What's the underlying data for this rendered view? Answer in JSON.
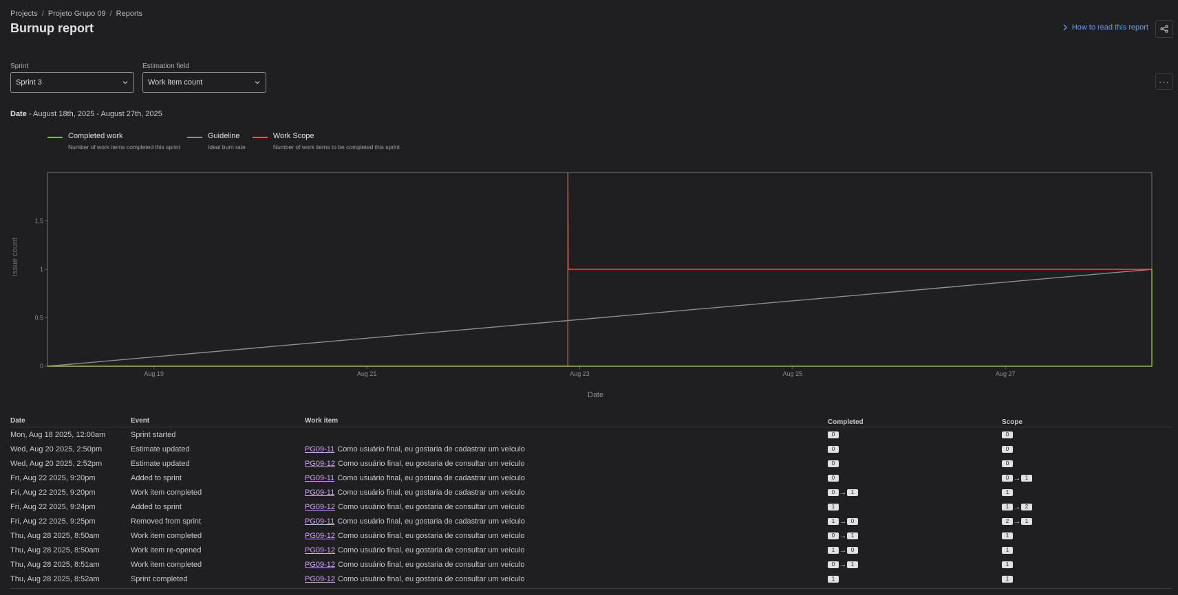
{
  "breadcrumb": {
    "projects": "Projects",
    "project": "Projeto Grupo 09",
    "reports": "Reports",
    "sep": "/"
  },
  "title": "Burnup report",
  "header": {
    "howto_label": "How to read this report"
  },
  "filters": {
    "sprint_label": "Sprint",
    "sprint_value": "Sprint 3",
    "estimation_label": "Estimation field",
    "estimation_value": "Work item count"
  },
  "date_range": {
    "label": "Date",
    "value": "- August 18th, 2025 - August 27th, 2025"
  },
  "legend": [
    {
      "name": "Completed work",
      "desc": "Number of work items completed this sprint",
      "color": "#82b536"
    },
    {
      "name": "Guideline",
      "desc": "Ideal burn rate",
      "color": "#8c8f93"
    },
    {
      "name": "Work Scope",
      "desc": "Number of work items to be completed this sprint",
      "color": "#e5534b"
    }
  ],
  "chart_data": {
    "type": "line",
    "xlabel": "Date",
    "ylabel": "Issue count",
    "x_ticks": [
      "Aug 19",
      "Aug 21",
      "Aug 23",
      "Aug 25",
      "Aug 27"
    ],
    "y_ticks": [
      "0",
      "0.5",
      "1",
      "1.5"
    ],
    "ylim": [
      0,
      2
    ],
    "xlim": [
      "2025-08-18",
      "2025-08-28 09:00"
    ],
    "grid": false,
    "legend_position": "top-left",
    "series": [
      {
        "name": "Completed work",
        "color": "#82b536",
        "points": [
          [
            "2025-08-18",
            0
          ],
          [
            "2025-08-28 09:00",
            0
          ],
          [
            "2025-08-28 09:00",
            1
          ]
        ]
      },
      {
        "name": "Guideline",
        "color": "#8c8f93",
        "points": [
          [
            "2025-08-18",
            0
          ],
          [
            "2025-08-28 09:00",
            1
          ]
        ]
      },
      {
        "name": "Work Scope",
        "color": "#e5534b",
        "points": [
          [
            "2025-08-18",
            0
          ],
          [
            "2025-08-22 21:20",
            0
          ],
          [
            "2025-08-22 21:20",
            2
          ],
          [
            "2025-08-22 21:25",
            1
          ],
          [
            "2025-08-28 09:00",
            1
          ]
        ]
      }
    ]
  },
  "table": {
    "headers": {
      "date": "Date",
      "event": "Event",
      "item": "Work item",
      "completed": "Completed",
      "scope": "Scope"
    },
    "rows": [
      {
        "date": "Mon, Aug 18 2025, 12:00am",
        "event": "Sprint started",
        "key": "",
        "summary": "",
        "completed": [
          "0"
        ],
        "scope": [
          "0"
        ]
      },
      {
        "date": "Wed, Aug 20 2025, 2:50pm",
        "event": "Estimate updated",
        "key": "PG09-11",
        "summary": "Como usuário final, eu gostaria de cadastrar um veículo",
        "completed": [
          "0"
        ],
        "scope": [
          "0"
        ]
      },
      {
        "date": "Wed, Aug 20 2025, 2:52pm",
        "event": "Estimate updated",
        "key": "PG09-12",
        "summary": "Como usuário final, eu gostaria de consultar um veículo",
        "completed": [
          "0"
        ],
        "scope": [
          "0"
        ]
      },
      {
        "date": "Fri, Aug 22 2025, 9:20pm",
        "event": "Added to sprint",
        "key": "PG09-11",
        "summary": "Como usuário final, eu gostaria de cadastrar um veículo",
        "completed": [
          "0"
        ],
        "scope": [
          "0",
          "1"
        ]
      },
      {
        "date": "Fri, Aug 22 2025, 9:20pm",
        "event": "Work item completed",
        "key": "PG09-11",
        "summary": "Como usuário final, eu gostaria de cadastrar um veículo",
        "completed": [
          "0",
          "1"
        ],
        "scope": [
          "1"
        ]
      },
      {
        "date": "Fri, Aug 22 2025, 9:24pm",
        "event": "Added to sprint",
        "key": "PG09-12",
        "summary": "Como usuário final, eu gostaria de consultar um veículo",
        "completed": [
          "1"
        ],
        "scope": [
          "1",
          "2"
        ]
      },
      {
        "date": "Fri, Aug 22 2025, 9:25pm",
        "event": "Removed from sprint",
        "key": "PG09-11",
        "summary": "Como usuário final, eu gostaria de cadastrar um veículo",
        "completed": [
          "1",
          "0"
        ],
        "scope": [
          "2",
          "1"
        ]
      },
      {
        "date": "Thu, Aug 28 2025, 8:50am",
        "event": "Work item completed",
        "key": "PG09-12",
        "summary": "Como usuário final, eu gostaria de consultar um veículo",
        "completed": [
          "0",
          "1"
        ],
        "scope": [
          "1"
        ]
      },
      {
        "date": "Thu, Aug 28 2025, 8:50am",
        "event": "Work item re-opened",
        "key": "PG09-12",
        "summary": "Como usuário final, eu gostaria de consultar um veículo",
        "completed": [
          "1",
          "0"
        ],
        "scope": [
          "1"
        ]
      },
      {
        "date": "Thu, Aug 28 2025, 8:51am",
        "event": "Work item completed",
        "key": "PG09-12",
        "summary": "Como usuário final, eu gostaria de consultar um veículo",
        "completed": [
          "0",
          "1"
        ],
        "scope": [
          "1"
        ]
      },
      {
        "date": "Thu, Aug 28 2025, 8:52am",
        "event": "Sprint completed",
        "key": "PG09-12",
        "summary": "Como usuário final, eu gostaria de consultar um veículo",
        "completed": [
          "1"
        ],
        "scope": [
          "1"
        ]
      }
    ]
  }
}
